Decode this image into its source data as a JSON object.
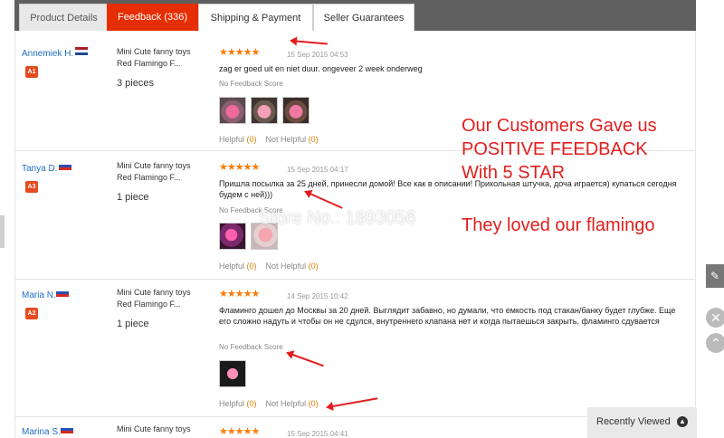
{
  "tabs": [
    {
      "label": "Product Details"
    },
    {
      "label": "Feedback (336)"
    },
    {
      "label": "Shipping & Payment"
    },
    {
      "label": "Seller Guarantees"
    }
  ],
  "reviews": [
    {
      "user": "Annemiek H.",
      "flag": "nl",
      "level": "A1",
      "product_line1": "Mini Cute fanny toys",
      "product_line2": "Red Flamingo F...",
      "quantity": "3 pieces",
      "stars": "★★★★★",
      "date": "15 Sep 2015 04:53",
      "text": "zag er goed uit en niet duur. ongeveer 2 week onderweg",
      "no_feedback": "No Feedback Score",
      "helpful_label": "Helpful",
      "helpful_count": "(0)",
      "not_helpful_label": "Not Helpful",
      "not_helpful_count": "(0)"
    },
    {
      "user": "Tanya D.",
      "flag": "ru",
      "level": "A3",
      "product_line1": "Mini Cute fanny toys",
      "product_line2": "Red Flamingo F...",
      "quantity": "1 piece",
      "stars": "★★★★★",
      "date": "15 Sep 2015 04:17",
      "text": "Пришла посылка за 25 дней, принесли домой! Все как в описании! Прикольная штучка, доча играется) купаться сегодня будем с ней)))",
      "no_feedback": "No Feedback Score",
      "helpful_label": "Helpful",
      "helpful_count": "(0)",
      "not_helpful_label": "Not Helpful",
      "not_helpful_count": "(0)"
    },
    {
      "user": "Maria N.",
      "flag": "ru",
      "level": "A2",
      "product_line1": "Mini Cute fanny toys",
      "product_line2": "Red Flamingo F...",
      "quantity": "1 piece",
      "stars": "★★★★★",
      "date": "14 Sep 2015 10:42",
      "text": "Фламинго дошел до Москвы за 20 дней. Выглядит забавно, но думали, что емкость под стакан/банку будет глубже. Еще его сложно надуть и чтобы он не сдулся, внутреннего клапана нет и когда пытаешься закрыть, фламинго сдувается",
      "no_feedback": "No Feedback Score",
      "helpful_label": "Helpful",
      "helpful_count": "(0)",
      "not_helpful_label": "Not Helpful",
      "not_helpful_count": "(0)"
    },
    {
      "user": "Marina S.",
      "flag": "ru",
      "product_line1": "Mini Cute fanny toys",
      "stars": "★★★★★",
      "date": "15 Sep 2015 04:41"
    }
  ],
  "overlay": {
    "line1": "Our Customers Gave us",
    "line2": "POSITIVE FEEDBACK",
    "line3": "With 5 STAR",
    "line4": "They loved our flamingo",
    "watermark": "Store No.: 1893056"
  },
  "recently_viewed": "Recently Viewed",
  "colors": {
    "active_tab": "#e62e04",
    "accent_text": "#e31e1e",
    "star": "#ff7a00",
    "link": "#1a6fc4"
  }
}
